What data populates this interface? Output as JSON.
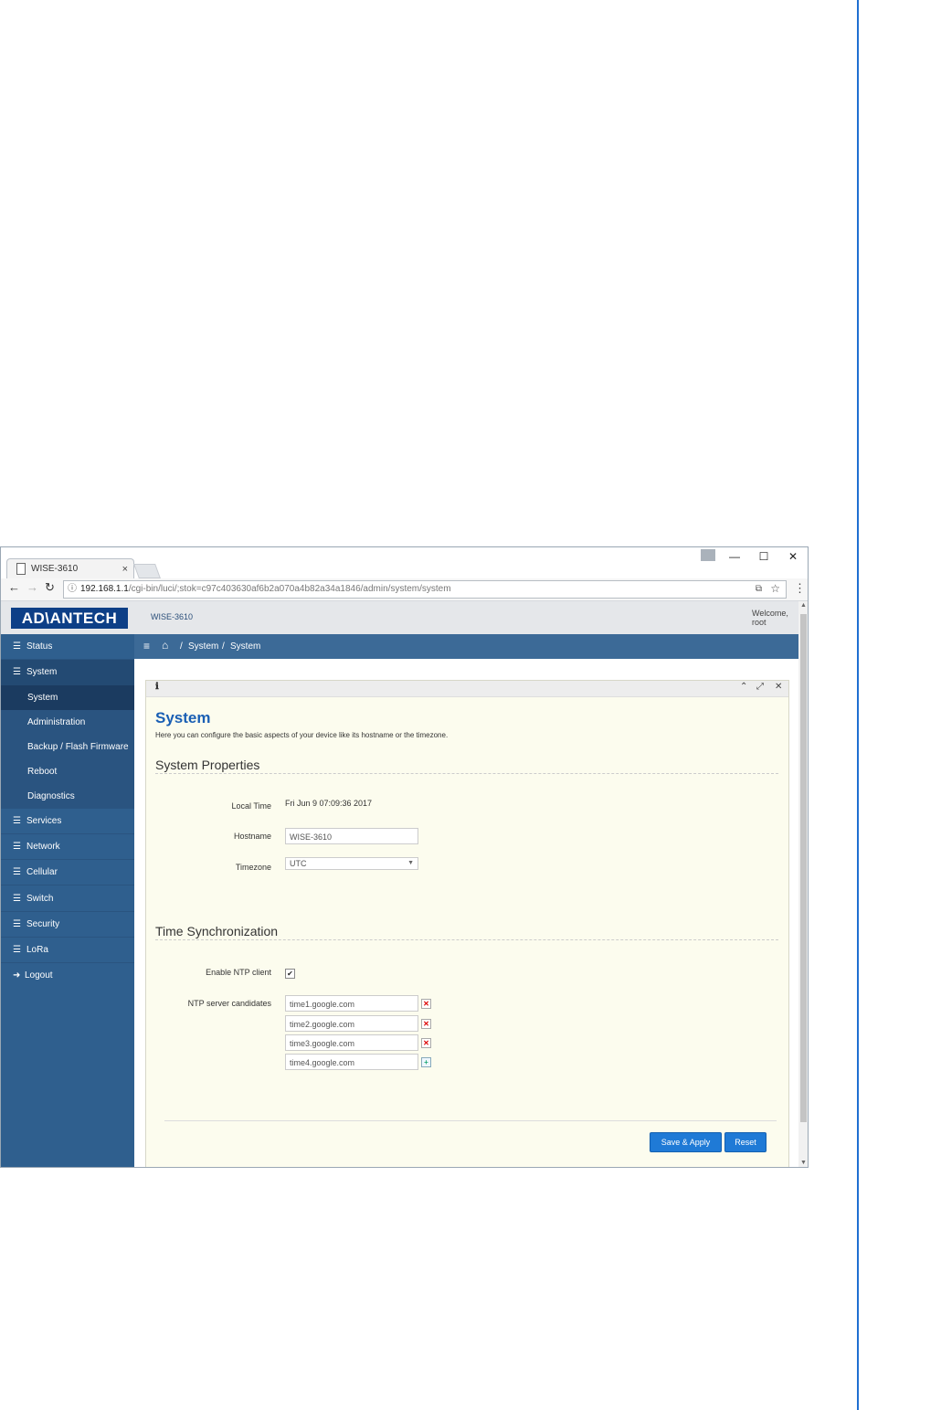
{
  "browser": {
    "tab_title": "WISE-3610",
    "tab_close": "×",
    "url_host": "192.168.1.1",
    "url_path": "/cgi-bin/luci/;stok=c97c403630af6b2a070a4b82a34a1846/admin/system/system",
    "controls": {
      "minimize": "—",
      "maximize": "☐",
      "close": "✕"
    }
  },
  "app": {
    "logo": "AD\\ANTECH",
    "device_name": "WISE-3610",
    "welcome": "Welcome,",
    "user": "root"
  },
  "sidebar": {
    "items": [
      {
        "label": "Status",
        "icon": "list-icon"
      },
      {
        "label": "System",
        "icon": "list-icon"
      },
      {
        "label": "Services",
        "icon": "list-icon"
      },
      {
        "label": "Network",
        "icon": "list-icon"
      },
      {
        "label": "Cellular",
        "icon": "list-icon"
      },
      {
        "label": "Switch",
        "icon": "list-icon"
      },
      {
        "label": "Security",
        "icon": "list-icon"
      },
      {
        "label": "LoRa",
        "icon": "list-icon"
      },
      {
        "label": "Logout",
        "icon": "logout-icon"
      }
    ],
    "system_sub": [
      "System",
      "Administration",
      "Backup / Flash Firmware",
      "Reboot",
      "Diagnostics"
    ]
  },
  "breadcrumb": {
    "sep": "/",
    "items": [
      "System",
      "System"
    ]
  },
  "page": {
    "title": "System",
    "description": "Here you can configure the basic aspects of your device like its hostname or the timezone.",
    "sections": {
      "properties": "System Properties",
      "sync": "Time Synchronization"
    },
    "fields": {
      "local_time_label": "Local Time",
      "local_time_value": "Fri Jun 9 07:09:36 2017",
      "hostname_label": "Hostname",
      "hostname_value": "WISE-3610",
      "timezone_label": "Timezone",
      "timezone_value": "UTC",
      "ntp_enable_label": "Enable NTP client",
      "ntp_enable_checked": true,
      "ntp_servers_label": "NTP server candidates",
      "ntp_servers": [
        "time1.google.com",
        "time2.google.com",
        "time3.google.com",
        "time4.google.com"
      ]
    },
    "buttons": {
      "save_apply": "Save & Apply",
      "reset": "Reset"
    }
  },
  "colors": {
    "accent": "#1f7ad6",
    "sidebar": "#2f5f8e",
    "page_rule": "#1f6fd1"
  }
}
